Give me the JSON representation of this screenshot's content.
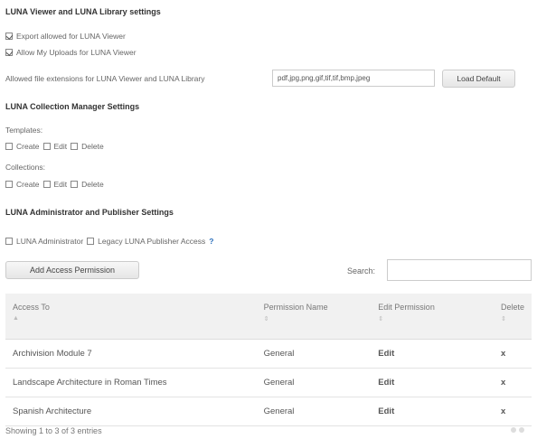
{
  "viewer_section": {
    "title": "LUNA Viewer and LUNA Library settings",
    "export_label": "Export allowed for LUNA Viewer",
    "uploads_label": "Allow My Uploads for LUNA Viewer",
    "extensions_label": "Allowed file extensions for LUNA Viewer and LUNA Library",
    "extensions_value": "pdf,jpg,png,gif,tif,tif,bmp,jpeg",
    "load_default_label": "Load Default"
  },
  "collection_section": {
    "title": "LUNA Collection Manager Settings",
    "templates_label": "Templates:",
    "collections_label": "Collections:",
    "create_label": "Create",
    "edit_label": "Edit",
    "delete_label": "Delete"
  },
  "admin_section": {
    "title": "LUNA Administrator and Publisher Settings",
    "admin_label": "LUNA Administrator",
    "legacy_label": "Legacy LUNA Publisher Access",
    "help_glyph": "?"
  },
  "toolbar": {
    "add_permission_label": "Add Access Permission",
    "search_label": "Search:",
    "search_value": ""
  },
  "table": {
    "columns": [
      "Access To",
      "Permission Name",
      "Edit Permission",
      "Delete"
    ],
    "sort_glyph_up": "▲",
    "sort_glyph_both": "⇕",
    "rows": [
      {
        "access_to": "Archivision Module 7",
        "permission": "General",
        "edit": "Edit",
        "delete": "x"
      },
      {
        "access_to": "Landscape Architecture in Roman Times",
        "permission": "General",
        "edit": "Edit",
        "delete": "x"
      },
      {
        "access_to": "Spanish Architecture",
        "permission": "General",
        "edit": "Edit",
        "delete": "x"
      }
    ]
  },
  "footer": {
    "info": "Showing 1 to 3 of 3 entries"
  }
}
